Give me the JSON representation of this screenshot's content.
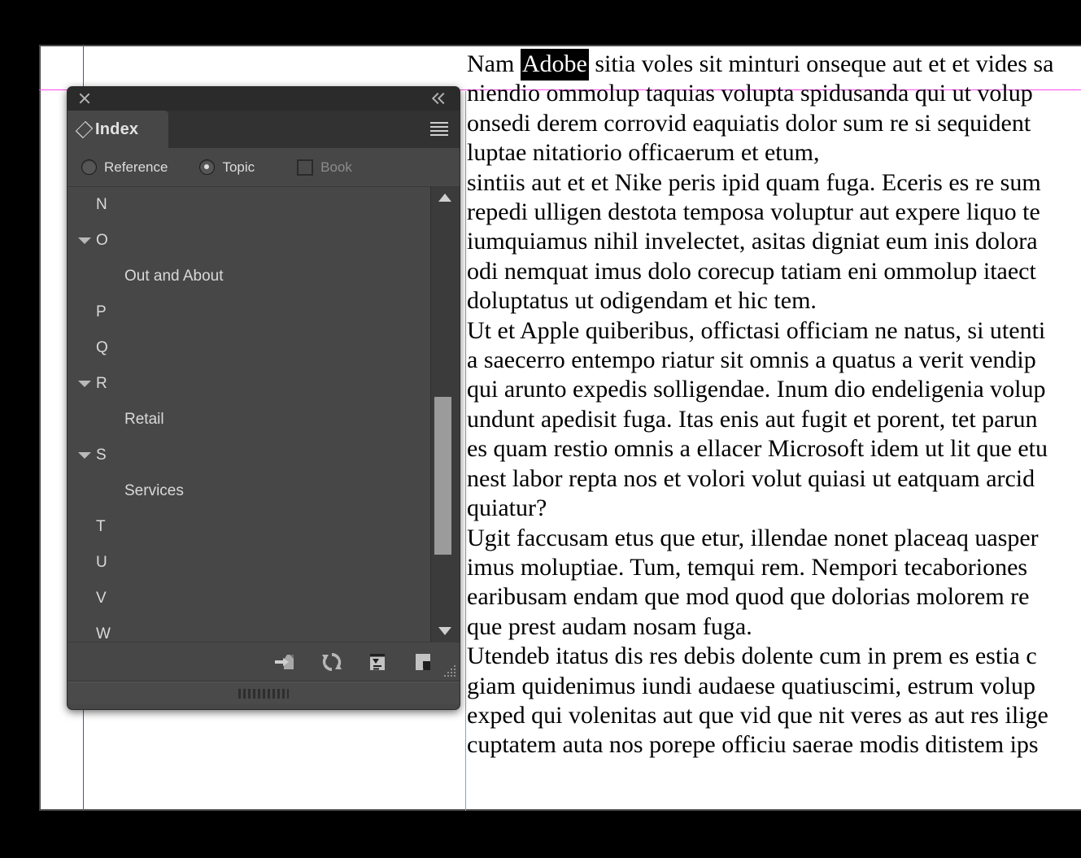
{
  "app": {
    "panel": {
      "title": "Index",
      "close_icon": "close-icon",
      "collapse_icon": "double-chevron-left-icon",
      "menu_icon": "panel-menu-icon",
      "tab_icon": "diamond-icon"
    },
    "options": {
      "reference": {
        "label": "Reference",
        "selected": false
      },
      "topic": {
        "label": "Topic",
        "selected": true
      },
      "book": {
        "label": "Book",
        "checked": false,
        "disabled": true
      }
    },
    "index_list": [
      {
        "text": "N",
        "type": "letter",
        "expanded": false
      },
      {
        "text": "O",
        "type": "letter",
        "expanded": true
      },
      {
        "text": "Out and About",
        "type": "entry"
      },
      {
        "text": "P",
        "type": "letter",
        "expanded": false
      },
      {
        "text": "Q",
        "type": "letter",
        "expanded": false
      },
      {
        "text": "R",
        "type": "letter",
        "expanded": true
      },
      {
        "text": "Retail",
        "type": "entry"
      },
      {
        "text": "S",
        "type": "letter",
        "expanded": true
      },
      {
        "text": "Services",
        "type": "entry"
      },
      {
        "text": "T",
        "type": "letter",
        "expanded": false
      },
      {
        "text": "U",
        "type": "letter",
        "expanded": false
      },
      {
        "text": "V",
        "type": "letter",
        "expanded": false
      },
      {
        "text": "W",
        "type": "letter",
        "expanded": false
      }
    ],
    "footer_buttons": [
      {
        "name": "create-new-index-entry-icon"
      },
      {
        "name": "update-preview-icon"
      },
      {
        "name": "generate-index-icon"
      },
      {
        "name": "go-to-selected-marker-icon"
      },
      {
        "name": "delete-selected-entry-icon"
      }
    ],
    "scrollbar": {
      "up_arrow": "scroll-up-arrow-icon",
      "down_arrow": "scroll-down-arrow-icon"
    },
    "resize_grip": "resize-grip-icon",
    "drag_grip": "drag-grip-icon"
  },
  "document": {
    "highlighted_word": "Adobe",
    "paragraphs": [
      {
        "lines": [
          {
            "pre": "Nam ",
            "highlight": "Adobe",
            "post": " sitia voles sit minturi onseque aut et et vides sa"
          },
          {
            "pre": "niendio ommolup taquias volupta spidusanda qui ut volup"
          },
          {
            "pre": "onsedi derem corrovid eaquiatis dolor sum re si sequident "
          },
          {
            "pre": "luptae nitatiorio officaerum et etum,"
          }
        ]
      },
      {
        "lines": [
          {
            "pre": "sintiis aut et et Nike peris ipid quam fuga. Eceris es re sum"
          },
          {
            "pre": "repedi ulligen destota temposa voluptur aut expere liquo te"
          },
          {
            "pre": "iumquiamus nihil invelectet, asitas digniat eum inis dolora"
          },
          {
            "pre": "odi nemquat imus dolo corecup tatiam eni ommolup itaect"
          },
          {
            "pre": "doluptatus ut odigendam et hic tem."
          }
        ]
      },
      {
        "lines": [
          {
            "pre": "Ut et Apple quiberibus, offictasi officiam ne natus, si utenti"
          },
          {
            "pre": "a saecerro entempo riatur sit omnis a quatus a verit vendip"
          },
          {
            "pre": "qui arunto expedis solligendae. Inum dio endeligenia volup"
          },
          {
            "pre": "undunt apedisit fuga. Itas enis aut fugit et porent, tet parun"
          },
          {
            "pre": "es quam restio omnis a ellacer Microsoft idem ut lit que etu"
          },
          {
            "pre": "nest labor repta nos et volori volut quiasi ut eatquam arcid"
          },
          {
            "pre": "quiatur?"
          }
        ]
      },
      {
        "lines": [
          {
            "pre": "Ugit faccusam etus que etur, illendae nonet placeaq uasper"
          },
          {
            "pre": "imus moluptiae. Tum, temqui rem. Nempori tecaboriones "
          },
          {
            "pre": "earibusam endam que mod quod que dolorias molorem re"
          },
          {
            "pre": "que prest audam nosam fuga."
          }
        ]
      },
      {
        "lines": [
          {
            "pre": "Utendeb itatus dis res debis dolente cum in prem es estia c"
          },
          {
            "pre": "giam quidenimus iundi audaese quatiuscimi, estrum volup"
          },
          {
            "pre": "exped qui volenitas aut que vid que nit veres as aut res ilige"
          },
          {
            "pre": "cuptatem auta nos porepe officiu saerae modis ditistem ips"
          }
        ]
      }
    ],
    "guides": {
      "margin_guide_color": "#ff4df0",
      "column_guide_color": "#8c2bd9",
      "text_frame_color": "#6fa8dc"
    }
  }
}
